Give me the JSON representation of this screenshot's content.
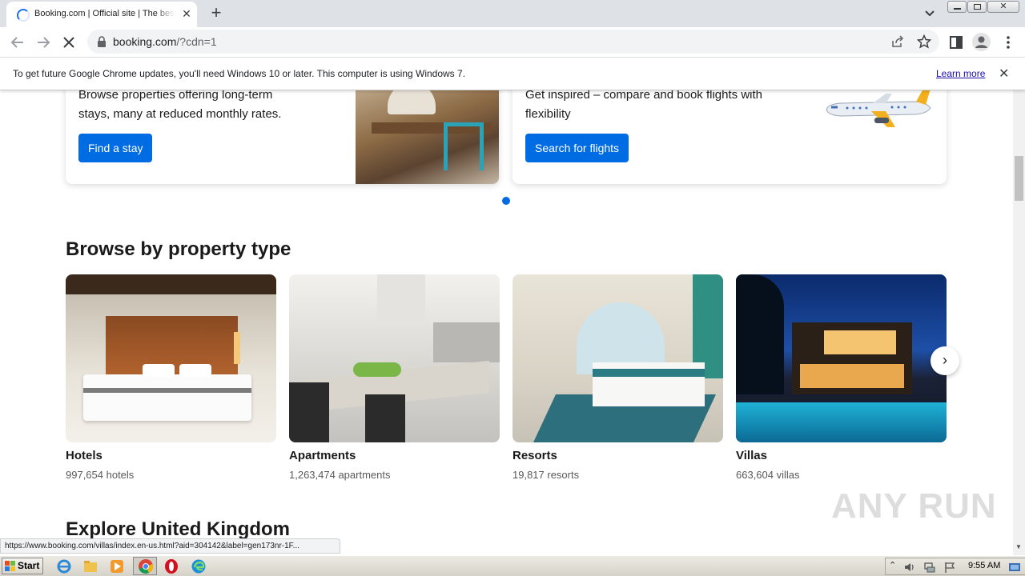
{
  "browser": {
    "tab_title": "Booking.com | Official site | The best hotels",
    "new_tab_label": "+",
    "tab_close": "✕",
    "url_host": "booking.com",
    "url_rest": "/?cdn=1"
  },
  "infobar": {
    "message": "To get future Google Chrome updates, you'll need Windows 10 or later. This computer is using Windows 7.",
    "link": "Learn more",
    "close": "✕"
  },
  "promo": {
    "stays_text_line1": "Browse properties offering long-term",
    "stays_text_line2": "stays, many at reduced monthly rates.",
    "stays_button": "Find a stay",
    "flights_text_line1": "Get inspired – compare and book flights with",
    "flights_text_line2": "flexibility",
    "flights_button": "Search for flights"
  },
  "property_section": {
    "heading": "Browse by property type",
    "items": [
      {
        "name": "Hotels",
        "count": "997,654 hotels"
      },
      {
        "name": "Apartments",
        "count": "1,263,474 apartments"
      },
      {
        "name": "Resorts",
        "count": "19,817 resorts"
      },
      {
        "name": "Villas",
        "count": "663,604 villas"
      }
    ],
    "next_arrow": "›"
  },
  "explore_heading": "Explore United Kingdom",
  "status_url": "https://www.booking.com/villas/index.en-us.html?aid=304142&label=gen173nr-1F...",
  "watermark": "ANY RUN",
  "taskbar": {
    "start_label": "Start",
    "clock": "9:55 AM"
  },
  "colors": {
    "brand_blue": "#006ce4",
    "chrome_frame": "#dee1e6"
  }
}
